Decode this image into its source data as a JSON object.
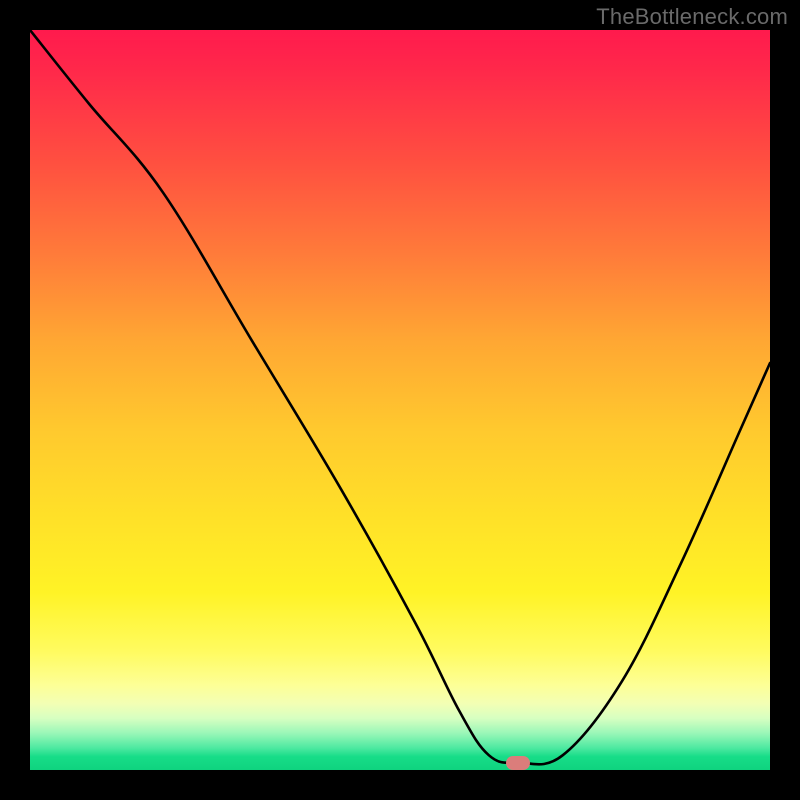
{
  "watermark": "TheBottleneck.com",
  "colors": {
    "frame_bg": "#000000",
    "curve": "#000000",
    "marker": "#db7d7b",
    "gradient_top": "#ff1a4d",
    "gradient_bottom": "#0fd37f"
  },
  "chart_data": {
    "type": "line",
    "title": "",
    "xlabel": "",
    "ylabel": "",
    "xlim": [
      0,
      100
    ],
    "ylim": [
      0,
      100
    ],
    "grid": false,
    "legend": false,
    "notes": "Background is a vertical red→yellow→green gradient suggesting bottleneck severity (top = high, bottom = optimal). The black curve shows bottleneck % vs. configuration; the pill marker indicates the current/optimal point near the minimum.",
    "series": [
      {
        "name": "bottleneck-curve",
        "x": [
          0,
          8,
          18,
          30,
          42,
          52,
          58,
          62,
          66,
          72,
          80,
          88,
          96,
          100
        ],
        "y": [
          100,
          90,
          78,
          58,
          38,
          20,
          8,
          2,
          1,
          2,
          12,
          28,
          46,
          55
        ]
      }
    ],
    "marker": {
      "x": 66,
      "y": 1
    }
  }
}
